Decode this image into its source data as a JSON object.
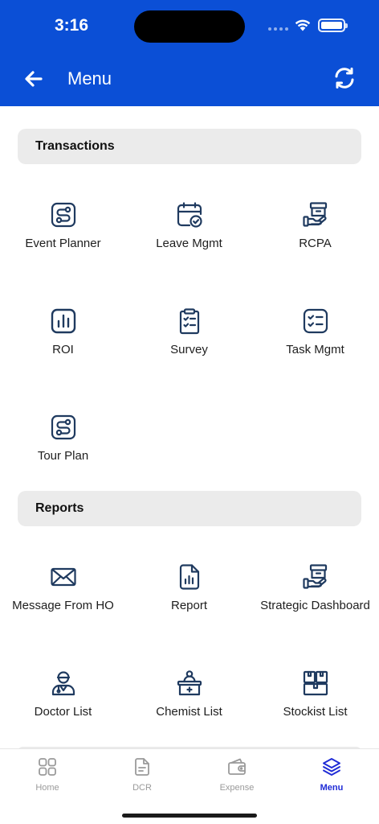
{
  "status_bar": {
    "time": "3:16"
  },
  "header": {
    "title": "Menu"
  },
  "sections": [
    {
      "title": "Transactions",
      "items": [
        {
          "label": "Event Planner",
          "icon": "route-icon"
        },
        {
          "label": "Leave Mgmt",
          "icon": "calendar-check-icon"
        },
        {
          "label": "RCPA",
          "icon": "box-hand-icon"
        },
        {
          "label": "ROI",
          "icon": "bar-chart-icon"
        },
        {
          "label": "Survey",
          "icon": "clipboard-check-icon"
        },
        {
          "label": "Task Mgmt",
          "icon": "checklist-icon"
        },
        {
          "label": "Tour Plan",
          "icon": "route-icon"
        }
      ]
    },
    {
      "title": "Reports",
      "items": [
        {
          "label": "Message From HO",
          "icon": "envelope-icon"
        },
        {
          "label": "Report",
          "icon": "document-chart-icon"
        },
        {
          "label": "Strategic Dashboard",
          "icon": "box-hand-icon"
        },
        {
          "label": "Doctor List",
          "icon": "doctor-icon"
        },
        {
          "label": "Chemist List",
          "icon": "pharmacist-counter-icon"
        },
        {
          "label": "Stockist List",
          "icon": "boxes-icon"
        }
      ]
    }
  ],
  "tabbar": [
    {
      "label": "Home",
      "icon": "grid-icon",
      "active": false
    },
    {
      "label": "DCR",
      "icon": "document-icon",
      "active": false
    },
    {
      "label": "Expense",
      "icon": "wallet-icon",
      "active": false
    },
    {
      "label": "Menu",
      "icon": "layers-icon",
      "active": true
    }
  ],
  "colors": {
    "header_bg": "#0b4fd6",
    "icon": "#1f3a5f",
    "active_tab": "#1f2bd6",
    "inactive_tab": "#9a9a9a"
  }
}
